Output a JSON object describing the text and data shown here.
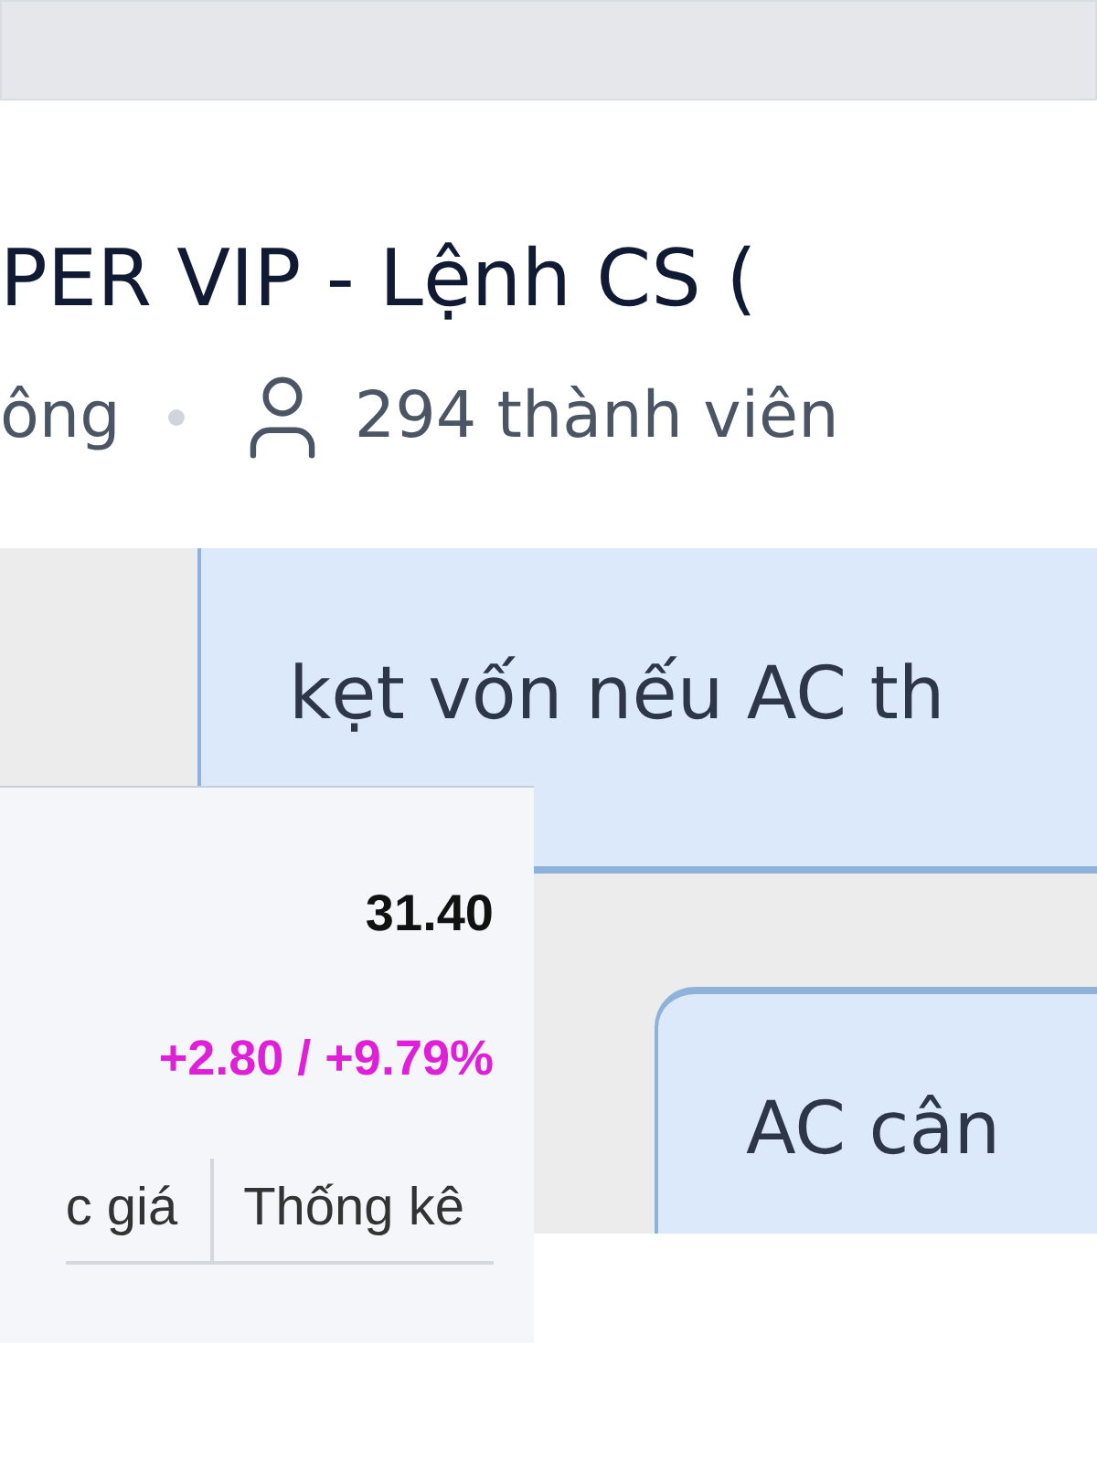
{
  "header": {
    "title": "PER VIP - Lệnh CS (",
    "status": "ông",
    "members": "294 thành viên"
  },
  "messages": [
    {
      "text": "kẹt vốn nếu AC th"
    },
    {
      "text": "AC cân"
    }
  ],
  "stock_widget": {
    "price": "31.40",
    "change": "+2.80 / +9.79%",
    "tabs": [
      {
        "label": "c giá",
        "selected": false
      },
      {
        "label": "Thống kê",
        "selected": false
      }
    ]
  }
}
